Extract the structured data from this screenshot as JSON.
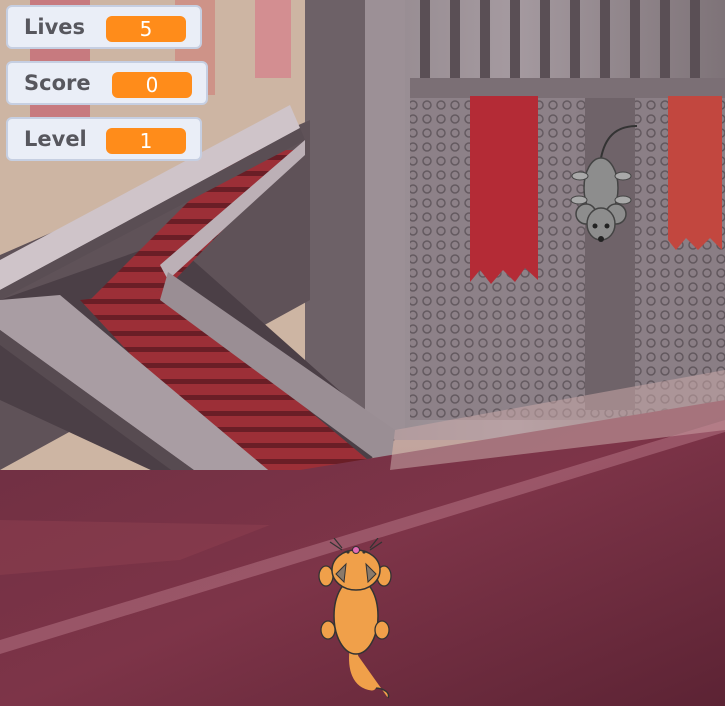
{
  "game": {
    "variables": [
      {
        "label": "Lives",
        "value": "5"
      },
      {
        "label": "Score",
        "value": "0"
      },
      {
        "label": "Level",
        "value": "1"
      }
    ],
    "sprites": [
      {
        "name": "cat",
        "icon": "cat-sprite"
      },
      {
        "name": "mouse",
        "icon": "mouse-sprite"
      }
    ],
    "backdrop": "castle-hall-staircase",
    "colors": {
      "monitor_bg": "#eaeef7",
      "monitor_border": "#c6cfe2",
      "value_pill": "#ff8c1a",
      "carpet": "#7a2f42",
      "cat": "#f0a04a",
      "mouse": "#8d8d8d"
    }
  }
}
